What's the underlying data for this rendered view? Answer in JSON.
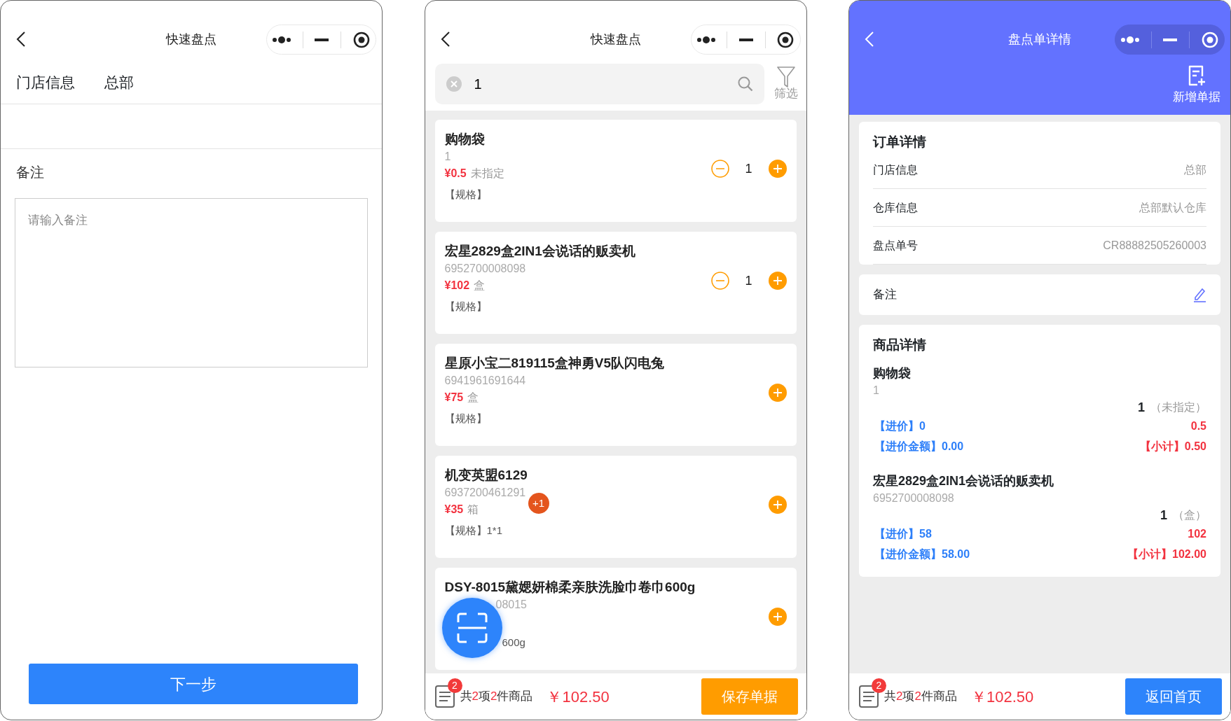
{
  "store_form": {
    "nav": {
      "title": "快速盘点"
    },
    "rows": [
      {
        "label": "门店信息",
        "value": "总部"
      }
    ],
    "remark": {
      "label": "备注",
      "placeholder": "请输入备注"
    },
    "next_button": "下一步"
  },
  "quick_count": {
    "nav": {
      "title": "快速盘点"
    },
    "search": {
      "value": "1"
    },
    "filter_label": "筛选",
    "products": [
      {
        "name": "购物袋",
        "barcode": "1",
        "price": "¥0.5",
        "unit": "未指定",
        "spec": "【规格】",
        "qty": "1"
      },
      {
        "name": "宏星2829盒2IN1会说话的贩卖机",
        "barcode": "6952700008098",
        "price": "¥102",
        "unit": "盒",
        "spec": "【规格】",
        "qty": "1"
      },
      {
        "name": "星原小宝二819115盒神勇V5队闪电兔",
        "barcode": "6941961691644",
        "price": "¥75",
        "unit": "盒",
        "spec": "【规格】"
      },
      {
        "name": "机变英盟6129",
        "barcode": "6937200461291",
        "price": "¥35",
        "unit": "箱",
        "spec": "【规格】1*1",
        "badge": "+1"
      },
      {
        "name": "DSY-8015黛媤妍棉柔亲肤洗脸巾卷巾600g",
        "barcode": "08015",
        "spec": "600g",
        "covered": true
      }
    ],
    "footer": {
      "badge": "2",
      "summary": [
        {
          "text": "共",
          "highlight": false
        },
        {
          "text": "2",
          "highlight": true
        },
        {
          "text": "项",
          "highlight": false
        },
        {
          "text": "2",
          "highlight": true
        },
        {
          "text": "件商品",
          "highlight": false
        }
      ],
      "total": "￥102.50",
      "button": "保存单据"
    }
  },
  "count_detail": {
    "nav": {
      "title": "盘点单详情"
    },
    "action_label": "新增单据",
    "order": {
      "title": "订单详情",
      "rows": [
        {
          "label": "门店信息",
          "value": "总部"
        },
        {
          "label": "仓库信息",
          "value": "总部默认仓库"
        },
        {
          "label": "盘点单号",
          "value": "CR88882505260003"
        }
      ]
    },
    "remark_label": "备注",
    "goods": {
      "title": "商品详情",
      "items": [
        {
          "name": "购物袋",
          "barcode": "1",
          "qty": "1",
          "unit": "（未指定）",
          "cost": "【进价】0",
          "price": "0.5",
          "cost_amount": "【进价金额】0.00",
          "subtotal": "【小计】0.50"
        },
        {
          "name": "宏星2829盒2IN1会说话的贩卖机",
          "barcode": "6952700008098",
          "qty": "1",
          "unit": "（盒）",
          "cost": "【进价】58",
          "price": "102",
          "cost_amount": "【进价金额】58.00",
          "subtotal": "【小计】102.00"
        }
      ]
    },
    "footer": {
      "badge": "2",
      "summary": [
        {
          "text": "共",
          "highlight": false
        },
        {
          "text": "2",
          "highlight": true
        },
        {
          "text": "项",
          "highlight": false
        },
        {
          "text": "2",
          "highlight": true
        },
        {
          "text": "件商品",
          "highlight": false
        }
      ],
      "total": "￥102.50",
      "button": "返回首页"
    }
  }
}
